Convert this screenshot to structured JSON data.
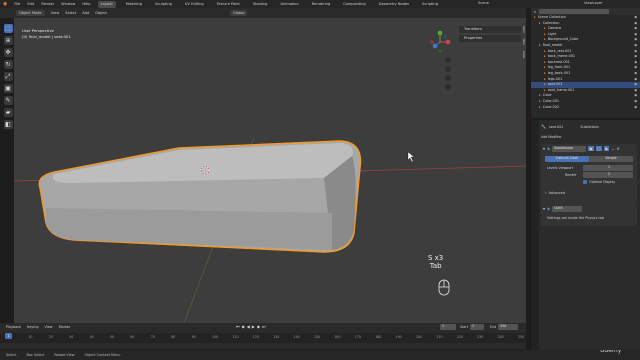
{
  "menu": {
    "items": [
      "File",
      "Edit",
      "Render",
      "Window",
      "Help"
    ],
    "tabs": [
      "Layout",
      "Modeling",
      "Sculpting",
      "UV Editing",
      "Texture Paint",
      "Shading",
      "Animation",
      "Rendering",
      "Compositing",
      "Geometry Nodes",
      "Scripting"
    ],
    "active_tab": "Layout",
    "scene_label": "Scene",
    "view_layer_label": "ViewLayer"
  },
  "viewport_header": {
    "mode": "Object Mode",
    "items": [
      "View",
      "Select",
      "Add",
      "Object"
    ],
    "orientation": "Global",
    "options": "Options"
  },
  "viewport": {
    "view_name": "User Perspective",
    "object_info": "(0) final_model | seat.001",
    "n_panel": [
      "Transform",
      "Properties"
    ],
    "key_hint_key": "S x3",
    "key_hint_key2": "Tab",
    "side_tabs": [
      "Item",
      "Tool",
      "View"
    ]
  },
  "timeline": {
    "items": [
      "Playback",
      "Keying",
      "View",
      "Marker"
    ],
    "current_frame": "1",
    "start_label": "Start",
    "start_value": "1",
    "end_label": "End",
    "end_value": "250",
    "ticks": [
      "0",
      "10",
      "20",
      "30",
      "40",
      "50",
      "60",
      "70",
      "80",
      "90",
      "100",
      "110",
      "120",
      "130",
      "140",
      "150",
      "160",
      "170",
      "180",
      "190",
      "200",
      "210",
      "220",
      "230",
      "240",
      "250"
    ]
  },
  "statusbar": [
    "Select",
    "Box Select",
    "Rotate View",
    "Object Context Menu"
  ],
  "outliner": {
    "search_placeholder": "",
    "rows": [
      {
        "label": "Scene Collection",
        "indent": 0,
        "sel": false
      },
      {
        "label": "Collection",
        "indent": 1,
        "sel": false
      },
      {
        "label": "Camera",
        "indent": 2,
        "sel": false
      },
      {
        "label": "Light",
        "indent": 2,
        "sel": false
      },
      {
        "label": "Background_Cube",
        "indent": 2,
        "sel": false
      },
      {
        "label": "final_model",
        "indent": 1,
        "sel": false
      },
      {
        "label": "back_rest.001",
        "indent": 2,
        "sel": false
      },
      {
        "label": "back_frame.001",
        "indent": 2,
        "sel": false
      },
      {
        "label": "backrest.001",
        "indent": 2,
        "sel": false
      },
      {
        "label": "leg_front.001",
        "indent": 2,
        "sel": false
      },
      {
        "label": "leg_back.001",
        "indent": 2,
        "sel": false
      },
      {
        "label": "legs.001",
        "indent": 2,
        "sel": false
      },
      {
        "label": "seat.001",
        "indent": 2,
        "sel": true
      },
      {
        "label": "seat_frame.001",
        "indent": 2,
        "sel": false
      },
      {
        "label": "Cube",
        "indent": 1,
        "sel": false
      },
      {
        "label": "Cube.001",
        "indent": 1,
        "sel": false
      },
      {
        "label": "Cube.002",
        "indent": 1,
        "sel": false
      }
    ]
  },
  "properties": {
    "object_name": "seat.001",
    "modifier_type": "Subdivision",
    "add_modifier": "Add Modifier",
    "modifier_name": "Subdivision",
    "tab_catmull": "Catmull-Clark",
    "tab_simple": "Simple",
    "levels_viewport_label": "Levels Viewport",
    "levels_viewport_value": "1",
    "render_label": "Render",
    "render_value": "2",
    "optimal_display": "Optimal Display",
    "advanced": "Advanced",
    "physics_label": "Cloth",
    "physics_note": "Settings are inside the Physics tab"
  },
  "watermark": "Udemy",
  "colors": {
    "accent_blue": "#4772b3",
    "selection_orange": "#f59a23",
    "viewport_bg": "#3d3d3d",
    "axis_red": "#a0413f",
    "axis_green": "#6d8a3b"
  }
}
